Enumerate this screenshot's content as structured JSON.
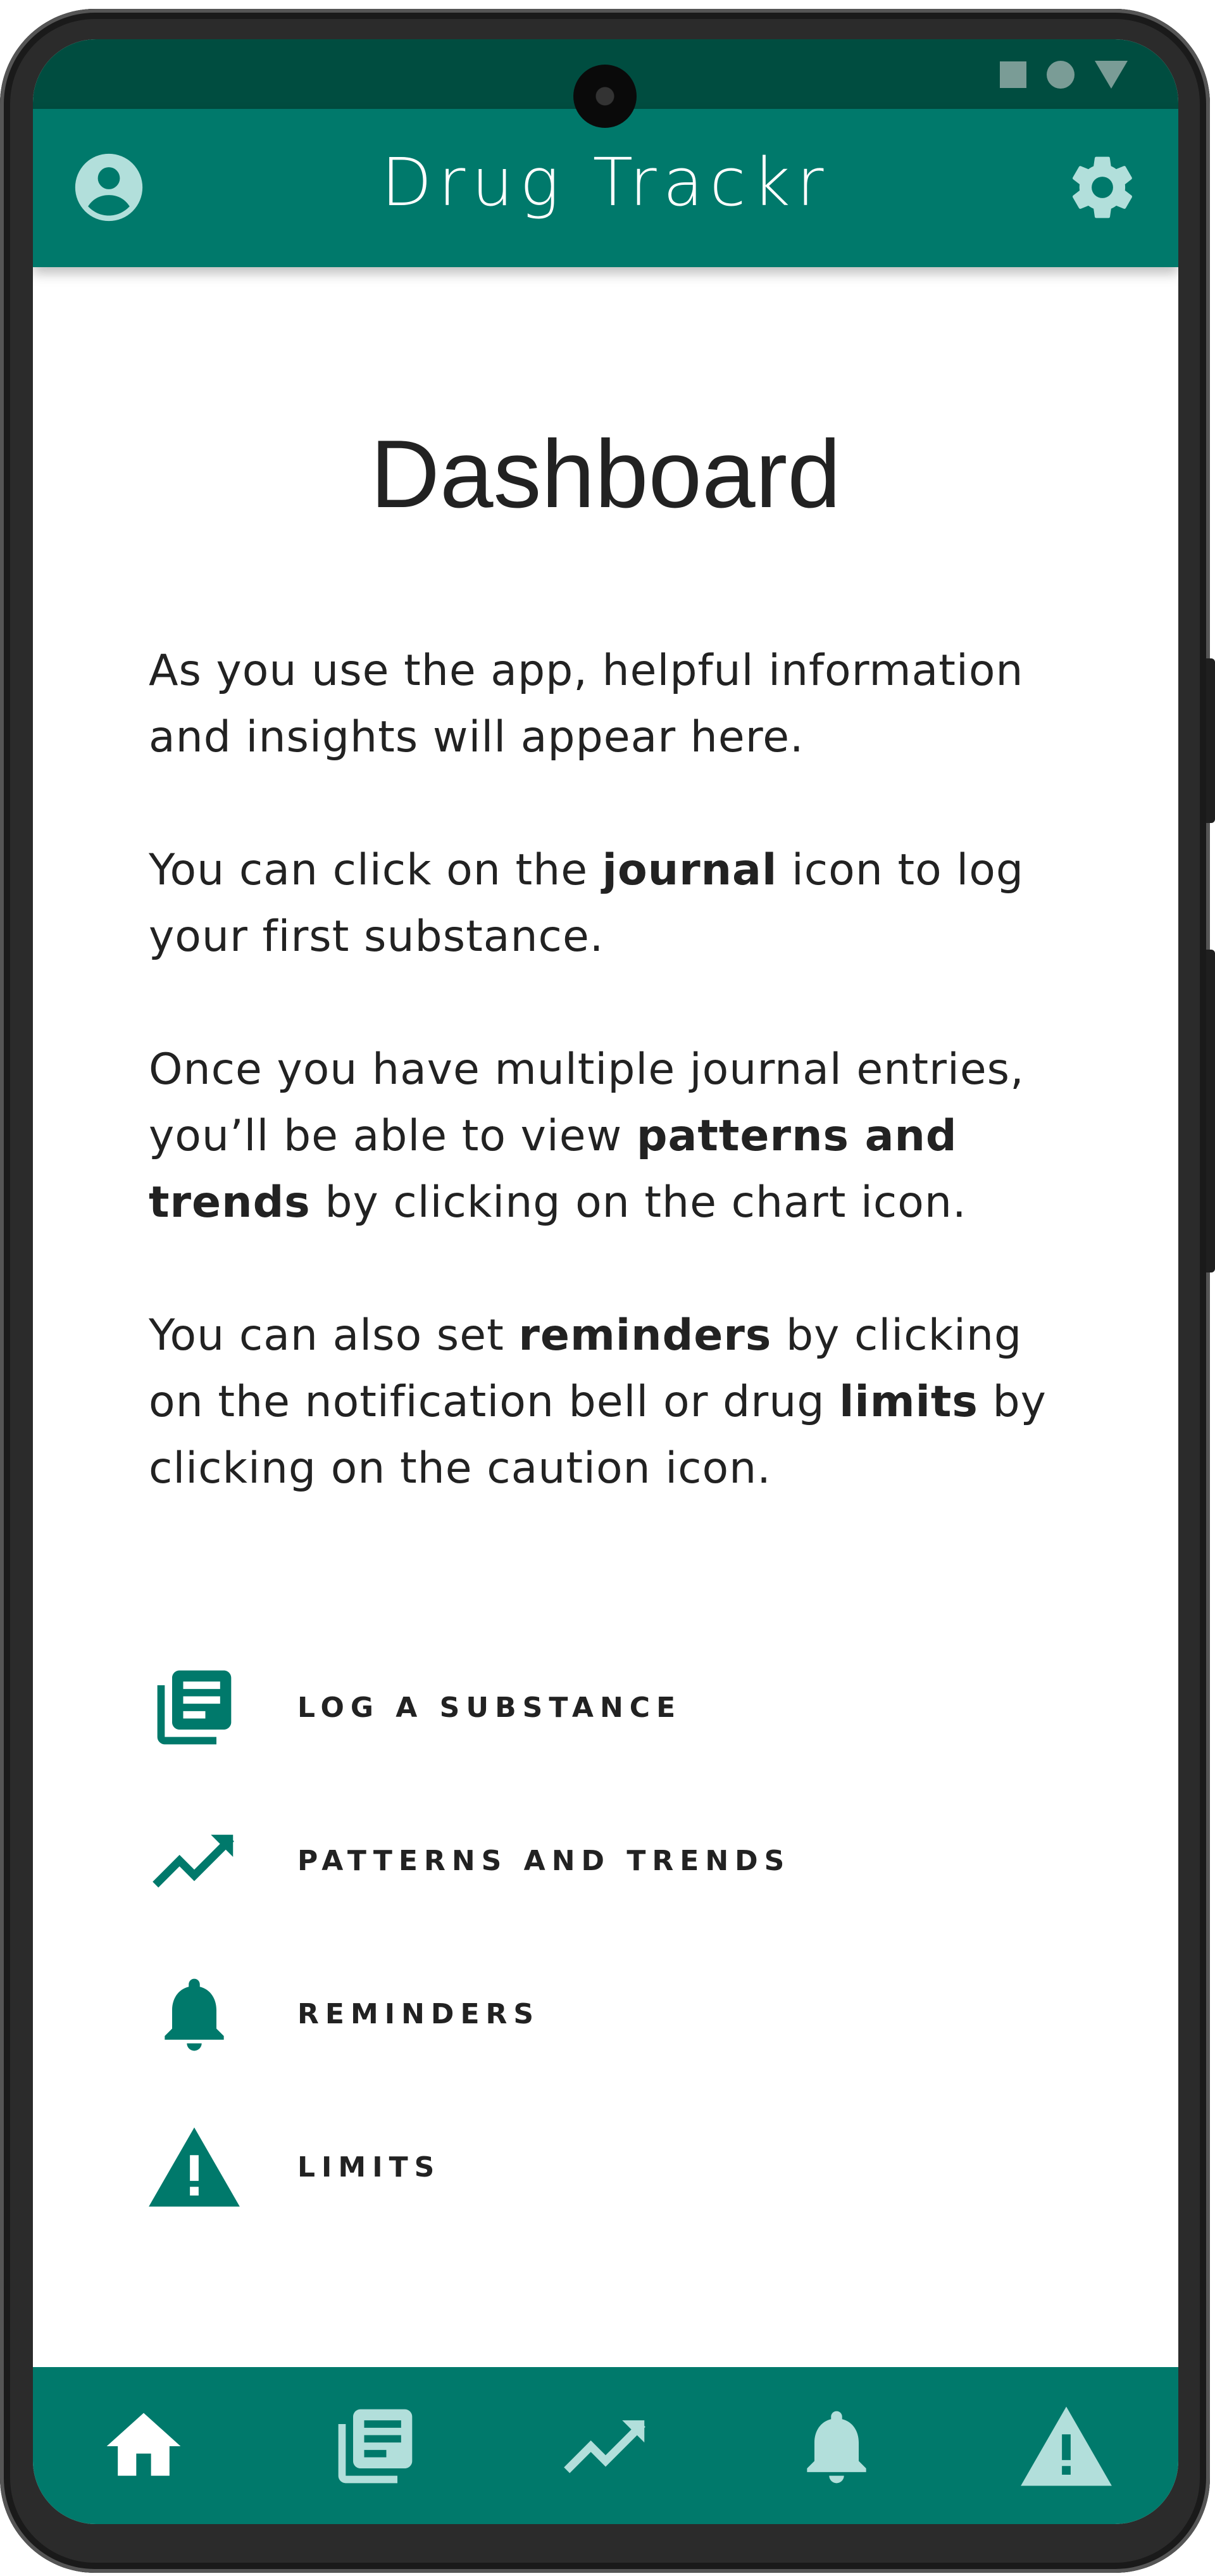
{
  "app": {
    "title": "Drug Trackr"
  },
  "page": {
    "title": "Dashboard",
    "intro": {
      "p1": "As you use the app, helpful information and insights will appear here.",
      "p2_before": "You can click on the ",
      "p2_bold": "journal",
      "p2_after": " icon to log your first substance.",
      "p3_before": "Once you have multiple journal entries, you’ll be able to view ",
      "p3_bold": "patterns and trends",
      "p3_after": " by clicking on the chart icon.",
      "p4_before": "You can also set ",
      "p4_bold1": "reminders",
      "p4_mid": " by clicking on the notification bell or drug ",
      "p4_bold2": "limits",
      "p4_after": " by clicking on the caution icon."
    }
  },
  "features": [
    {
      "label": "LOG A SUBSTANCE",
      "icon": "journal-icon"
    },
    {
      "label": "PATTERNS AND TRENDS",
      "icon": "trend-chart-icon"
    },
    {
      "label": "REMINDERS",
      "icon": "bell-icon"
    },
    {
      "label": "LIMITS",
      "icon": "warning-icon"
    }
  ],
  "bottom_nav": [
    {
      "name": "home",
      "icon": "home-icon",
      "active": true
    },
    {
      "name": "journal",
      "icon": "journal-icon",
      "active": false
    },
    {
      "name": "patterns",
      "icon": "trend-chart-icon",
      "active": false
    },
    {
      "name": "reminders",
      "icon": "bell-icon",
      "active": false
    },
    {
      "name": "limits",
      "icon": "warning-icon",
      "active": false
    }
  ],
  "colors": {
    "primary": "#00796b",
    "primary_dark": "#004d40",
    "icon_light": "#b2dfdb",
    "text": "#222222"
  }
}
